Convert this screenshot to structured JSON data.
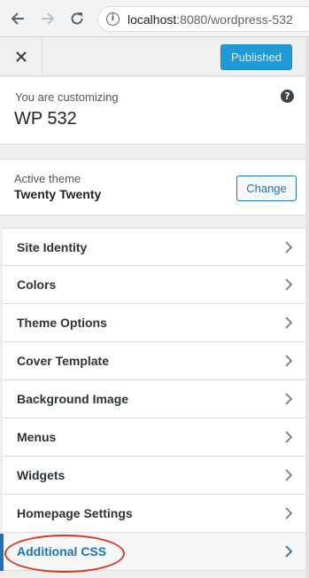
{
  "browser": {
    "url_host": "localhost",
    "url_rest": ":8080/wordpress-532"
  },
  "header": {
    "publish_label": "Published"
  },
  "customizing": {
    "label": "You are customizing",
    "site_name": "WP 532",
    "help_symbol": "?"
  },
  "theme": {
    "label": "Active theme",
    "name": "Twenty Twenty",
    "change_label": "Change"
  },
  "panels": [
    {
      "label": "Site Identity"
    },
    {
      "label": "Colors"
    },
    {
      "label": "Theme Options"
    },
    {
      "label": "Cover Template"
    },
    {
      "label": "Background Image"
    },
    {
      "label": "Menus"
    },
    {
      "label": "Widgets"
    },
    {
      "label": "Homepage Settings"
    },
    {
      "label": "Additional CSS"
    }
  ],
  "colors": {
    "accent": "#2271b1",
    "publish_bg": "#1e9ad6",
    "annotation": "#d93a25"
  },
  "icons": {
    "back": "arrow-left-icon",
    "forward": "arrow-right-icon",
    "reload": "reload-icon",
    "info": "info-icon",
    "close": "close-icon",
    "help": "help-icon",
    "chevron": "chevron-right-icon"
  }
}
